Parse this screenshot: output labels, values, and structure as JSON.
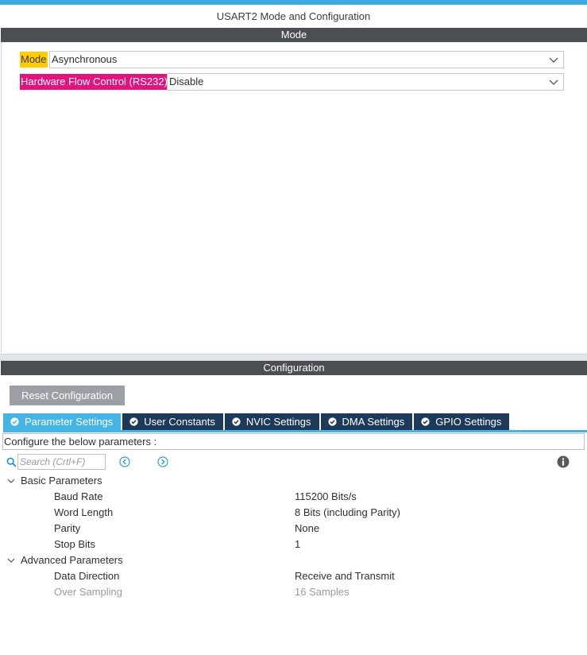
{
  "window": {
    "title": "USART2 Mode and Configuration"
  },
  "mode_section": {
    "header": "Mode",
    "fields": [
      {
        "label": "Mode",
        "value": "Asynchronous",
        "label_color": "#ffcc00"
      },
      {
        "label": "Hardware Flow Control (RS232)",
        "value": "Disable",
        "label_color": "#e2137c"
      }
    ]
  },
  "config_section": {
    "header": "Configuration",
    "reset_label": "Reset Configuration",
    "tabs": [
      {
        "label": "Parameter Settings",
        "active": true
      },
      {
        "label": "User Constants",
        "active": false
      },
      {
        "label": "NVIC Settings",
        "active": false
      },
      {
        "label": "DMA Settings",
        "active": false
      },
      {
        "label": "GPIO Settings",
        "active": false
      }
    ],
    "note": "Configure the below parameters :",
    "search": {
      "value": "",
      "placeholder": "Search (Crtl+F)"
    },
    "groups": [
      {
        "name": "Basic Parameters",
        "params": [
          {
            "name": "Baud Rate",
            "value": "115200 Bits/s",
            "enabled": true
          },
          {
            "name": "Word Length",
            "value": "8 Bits (including Parity)",
            "enabled": true
          },
          {
            "name": "Parity",
            "value": "None",
            "enabled": true
          },
          {
            "name": "Stop Bits",
            "value": "1",
            "enabled": true
          }
        ]
      },
      {
        "name": "Advanced Parameters",
        "params": [
          {
            "name": "Data Direction",
            "value": "Receive and Transmit",
            "enabled": true
          },
          {
            "name": "Over Sampling",
            "value": "16 Samples",
            "enabled": false
          }
        ]
      }
    ]
  },
  "icons": {
    "search": "search-icon",
    "prev": "chevron-left-circle-icon",
    "next": "chevron-right-circle-icon",
    "info": "info-icon",
    "tab_check": "check-circle-icon",
    "dropdown": "chevron-down-icon",
    "expand": "expand-triangle-icon"
  },
  "colors": {
    "accent": "#3da8dc",
    "active_tab": "#44b4e4",
    "inactive_tab": "#1d3a5a",
    "section_bar": "#4b4f53",
    "mode_highlight": "#ffcc00",
    "flow_highlight": "#e2137c"
  }
}
